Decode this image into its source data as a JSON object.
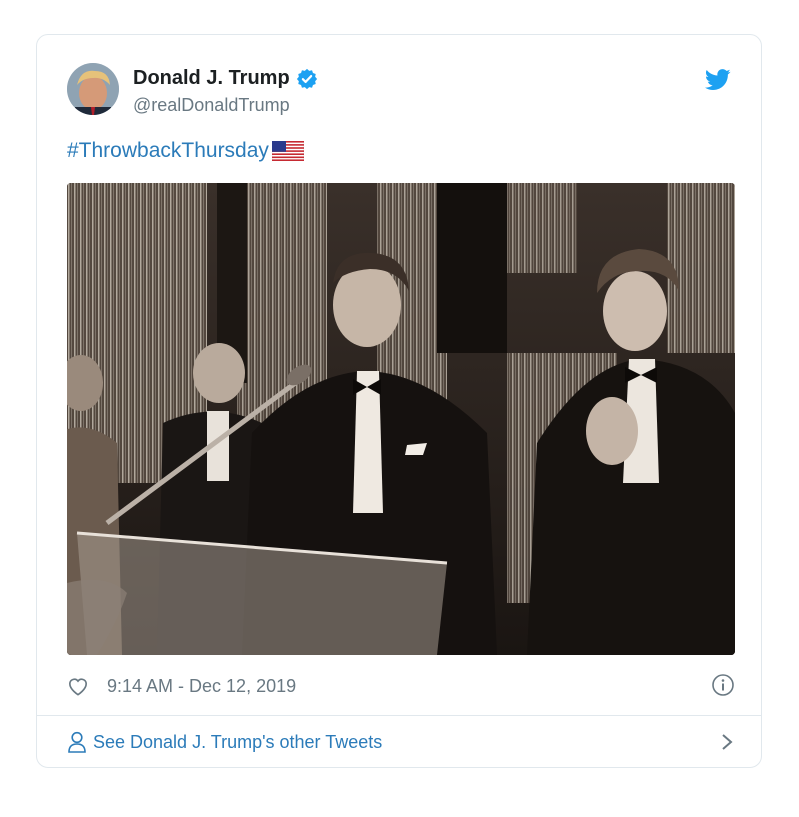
{
  "tweet": {
    "author_name": "Donald J. Trump",
    "handle": "@realDonaldTrump",
    "text": "#ThrowbackThursday",
    "timestamp": "9:14 AM - Dec 12, 2019",
    "see_more": "See Donald J. Trump's other Tweets"
  },
  "icons": {
    "verified": "verified-badge-icon",
    "brand": "twitter-bird-icon",
    "flag": "us-flag-emoji",
    "like": "heart-icon",
    "info": "info-icon",
    "profile": "person-icon",
    "next": "chevron-right-icon"
  },
  "colors": {
    "link": "#2b7bb9",
    "verified": "#1da1f2",
    "secondary_text": "#697882",
    "primary_text": "#1c2022",
    "border": "#e1e8ed"
  }
}
